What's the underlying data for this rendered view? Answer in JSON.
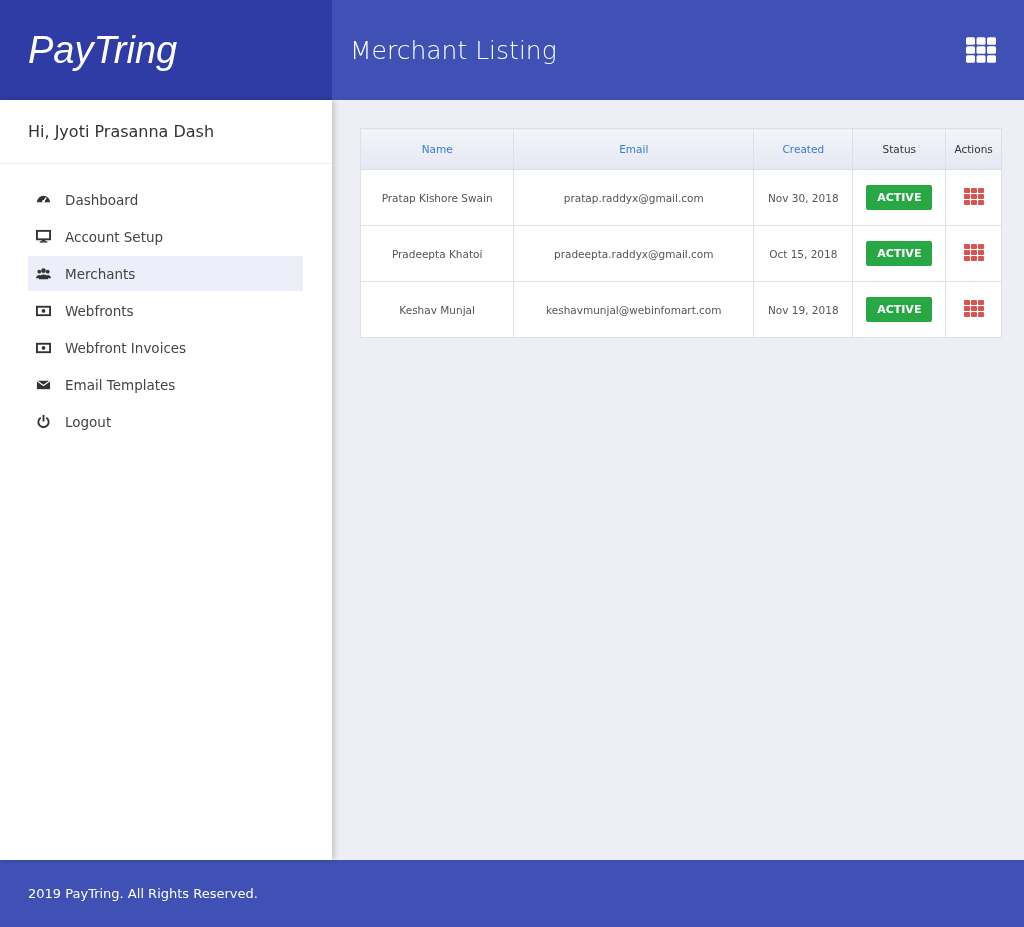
{
  "brand": {
    "name": "PayTring"
  },
  "header": {
    "title": "Merchant Listing"
  },
  "sidebar": {
    "greeting": "Hi, Jyoti Prasanna Dash",
    "items": [
      {
        "label": "Dashboard",
        "kind": "gauge",
        "selected": false
      },
      {
        "label": "Account Setup",
        "kind": "monitor",
        "selected": false
      },
      {
        "label": "Merchants",
        "kind": "users",
        "selected": true
      },
      {
        "label": "Webfronts",
        "kind": "money",
        "selected": false
      },
      {
        "label": "Webfront Invoices",
        "kind": "money",
        "selected": false
      },
      {
        "label": "Email Templates",
        "kind": "envelope",
        "selected": false
      },
      {
        "label": "Logout",
        "kind": "power",
        "selected": false
      }
    ]
  },
  "table": {
    "columns": [
      {
        "label": "Name",
        "sortable": true
      },
      {
        "label": "Email",
        "sortable": true
      },
      {
        "label": "Created",
        "sortable": true
      },
      {
        "label": "Status",
        "sortable": false
      },
      {
        "label": "Actions",
        "sortable": false
      }
    ],
    "rows": [
      {
        "name": "Pratap Kishore Swain",
        "email": "pratap.raddyx@gmail.com",
        "created": "Nov 30, 2018",
        "status": "ACTIVE",
        "color": "#28a745"
      },
      {
        "name": "Pradeepta Khatoi",
        "email": "pradeepta.raddyx@gmail.com",
        "created": "Oct 15, 2018",
        "status": "ACTIVE",
        "color": "#28a745"
      },
      {
        "name": "Keshav Munjal",
        "email": "keshavmunjal@webinfomart.com",
        "created": "Nov 19, 2018",
        "status": "ACTIVE",
        "color": "#28a745"
      }
    ]
  },
  "footer": {
    "text": "2019 PayTring. All Rights Reserved."
  }
}
